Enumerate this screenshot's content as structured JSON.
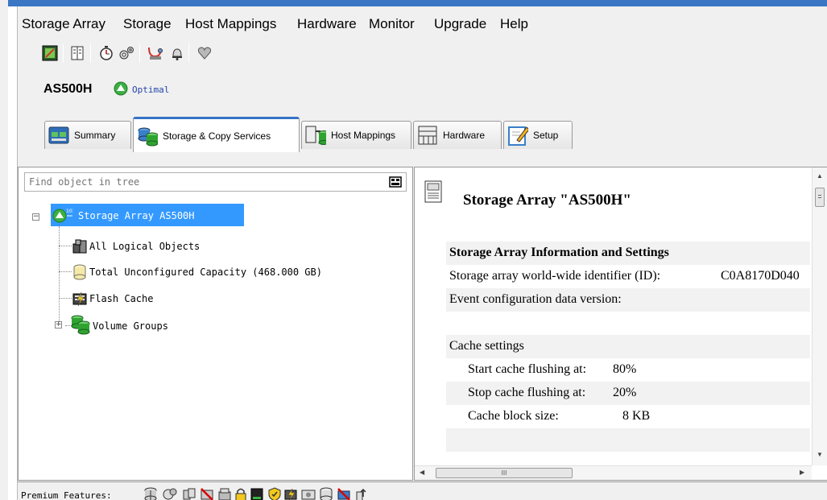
{
  "menu": [
    {
      "label": "Storage Array"
    },
    {
      "label": "Storage"
    },
    {
      "label": "Host Mappings"
    },
    {
      "label": "Hardware"
    },
    {
      "label": "Monitor"
    },
    {
      "label": "Upgrade"
    },
    {
      "label": "Help"
    }
  ],
  "toolbar_icons": [
    "array-management-icon",
    "grid-view-icon",
    "performance-monitor-icon",
    "settings-gears-icon",
    "support-data-icon",
    "alert-bell-icon",
    "recovery-heart-icon"
  ],
  "array": {
    "name": "AS500H",
    "status": "Optimal",
    "status_color": "#3cb043"
  },
  "tabs": [
    {
      "label": "Summary",
      "icon": "summary-icon"
    },
    {
      "label": "Storage & Copy Services",
      "icon": "storage-services-icon",
      "active": true
    },
    {
      "label": "Host Mappings",
      "icon": "host-mappings-icon"
    },
    {
      "label": "Hardware",
      "icon": "hardware-icon"
    },
    {
      "label": "Setup",
      "icon": "setup-icon"
    }
  ],
  "search": {
    "placeholder": "Find object in tree"
  },
  "tree": [
    {
      "label": "Storage Array AS500H",
      "selected": true
    },
    {
      "label": "All Logical Objects"
    },
    {
      "label": "Total Unconfigured Capacity (468.000 GB)"
    },
    {
      "label": "Flash Cache"
    },
    {
      "label": "Volume Groups"
    }
  ],
  "detail": {
    "title": "Storage Array \"AS500H\"",
    "section_heading": "Storage Array Information and Settings",
    "wwid_label": "Storage array world-wide identifier (ID):",
    "wwid_value": "C0A8170D040",
    "event_config_label": "Event configuration data version:",
    "cache_heading": "Cache settings",
    "start_flush_label": "Start cache flushing at:",
    "start_flush_value": "80%",
    "stop_flush_label": "Stop cache flushing at:",
    "stop_flush_value": "20%",
    "block_size_label": "Cache block size:",
    "block_size_value": "8 KB"
  },
  "scroll_glyphs": {
    "up": "▲",
    "down": "▼",
    "left": "◀",
    "right": "▶",
    "thumb": "III"
  },
  "premium": {
    "label": "Premium Features:",
    "icons": [
      "storage-partitions-icon",
      "snapshot-icon",
      "volume-copy-icon",
      "remote-mirror-disabled-icon",
      "performance-tier-icon",
      "security-lock-icon",
      "ssd-icon",
      "data-assurance-icon",
      "flash-cache-icon",
      "drive-slots-icon",
      "dynamic-disk-pools-icon",
      "thin-provisioning-disabled-icon",
      "upgrade-icon"
    ]
  },
  "colors": {
    "accent": "#3574c6",
    "selection": "#3399ff",
    "green": "#3cb043"
  }
}
